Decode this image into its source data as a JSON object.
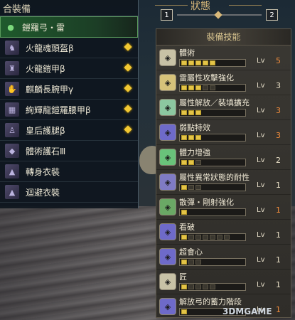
{
  "equipment": {
    "header": "合裝備",
    "items": [
      {
        "label": "鎧羅弓・雷",
        "icon": "bow-icon",
        "selected": true,
        "has_deco": false
      },
      {
        "label": "火龍魂頭盔β",
        "icon": "helmet-icon",
        "selected": false,
        "has_deco": true
      },
      {
        "label": "火龍鎧甲β",
        "icon": "chest-armor-icon",
        "selected": false,
        "has_deco": true
      },
      {
        "label": "麒麟長腕甲γ",
        "icon": "arm-armor-icon",
        "selected": false,
        "has_deco": true
      },
      {
        "label": "絢輝龍鎧羅腰甲β",
        "icon": "waist-armor-icon",
        "selected": false,
        "has_deco": true
      },
      {
        "label": "皇后護腿β",
        "icon": "leg-armor-icon",
        "selected": false,
        "has_deco": true
      },
      {
        "label": "體術護石Ⅲ",
        "icon": "charm-icon",
        "selected": false,
        "has_deco": false
      },
      {
        "label": "轉身衣裝",
        "icon": "mantle-icon",
        "selected": false,
        "has_deco": false
      },
      {
        "label": "迴避衣裝",
        "icon": "mantle-icon",
        "selected": false,
        "has_deco": false
      }
    ]
  },
  "status": {
    "title": "狀態",
    "page_prev": "1",
    "page_next": "2"
  },
  "skills": {
    "header": "裝備技能",
    "lv_label": "Lv",
    "colors": {
      "pip_on": "#e4c447",
      "max_level": "#f08c3c",
      "normal_level": "#e8dfc6"
    },
    "items": [
      {
        "name": "體術",
        "level": 5,
        "max_pips": 5,
        "maxed": true,
        "icon_color": "#c8c2a6"
      },
      {
        "name": "雷屬性攻擊強化",
        "level": 3,
        "max_pips": 5,
        "maxed": false,
        "icon_color": "#d6c27a"
      },
      {
        "name": "屬性解放／裝填擴充",
        "level": 3,
        "max_pips": 3,
        "maxed": true,
        "icon_color": "#8cc7a0"
      },
      {
        "name": "弱點特效",
        "level": 3,
        "max_pips": 3,
        "maxed": true,
        "icon_color": "#6e6ac9"
      },
      {
        "name": "體力增強",
        "level": 2,
        "max_pips": 3,
        "maxed": false,
        "icon_color": "#69c27a"
      },
      {
        "name": "屬性異常狀態的耐性",
        "level": 1,
        "max_pips": 3,
        "maxed": false,
        "icon_color": "#7f7bc4"
      },
      {
        "name": "散彈・剛射強化",
        "level": 1,
        "max_pips": 1,
        "maxed": true,
        "icon_color": "#6aa865"
      },
      {
        "name": "看破",
        "level": 1,
        "max_pips": 7,
        "maxed": false,
        "icon_color": "#6e6ac9"
      },
      {
        "name": "超會心",
        "level": 1,
        "max_pips": 3,
        "maxed": false,
        "icon_color": "#6e6ac9"
      },
      {
        "name": "匠",
        "level": 1,
        "max_pips": 5,
        "maxed": false,
        "icon_color": "#c8c2a6"
      },
      {
        "name": "解放弓的蓄力階段",
        "level": 1,
        "max_pips": 1,
        "maxed": true,
        "icon_color": "#6e6ac9"
      }
    ]
  },
  "watermark": "3DMGAME"
}
